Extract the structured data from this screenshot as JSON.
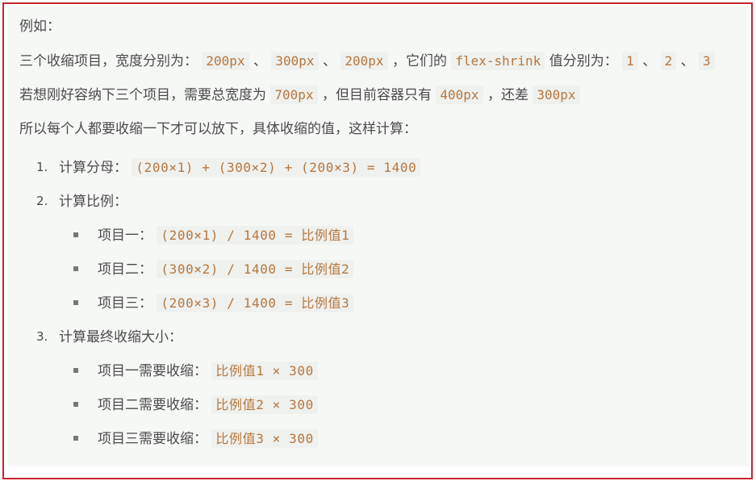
{
  "intro": {
    "line1": "例如：",
    "line2": {
      "prefix": "三个收缩项目，宽度分别为：",
      "w1": "200px",
      "sep1": "、",
      "w2": "300px",
      "sep2": "、",
      "w3": "200px",
      "mid": "，它们的",
      "prop": "flex-shrink",
      "mid2": "值分别为：",
      "v1": "1",
      "sep3": "、",
      "v2": "2",
      "sep4": "、",
      "v3": "3"
    },
    "line3": {
      "prefix": "若想刚好容纳下三个项目，需要总宽度为",
      "total": "700px",
      "mid": "，但目前容器只有",
      "container": "400px",
      "mid2": "，还差",
      "diff": "300px"
    },
    "line4": "所以每个人都要收缩一下才可以放下，具体收缩的值，这样计算："
  },
  "steps": [
    {
      "number": "1.",
      "label": "计算分母：",
      "code": "(200×1) + (300×2) + (200×3) = 1400"
    },
    {
      "number": "2.",
      "label": "计算比例：",
      "items": [
        {
          "label": "项目一：",
          "code": "(200×1) / 1400 = 比例值1"
        },
        {
          "label": "项目二：",
          "code": "(300×2) / 1400 = 比例值2"
        },
        {
          "label": "项目三：",
          "code": "(200×3) / 1400 = 比例值3"
        }
      ]
    },
    {
      "number": "3.",
      "label": "计算最终收缩大小：",
      "items": [
        {
          "label": "项目一需要收缩：",
          "code": "比例值1 × 300"
        },
        {
          "label": "项目二需要收缩：",
          "code": "比例值2 × 300"
        },
        {
          "label": "项目三需要收缩：",
          "code": "比例值3 × 300"
        }
      ]
    }
  ]
}
